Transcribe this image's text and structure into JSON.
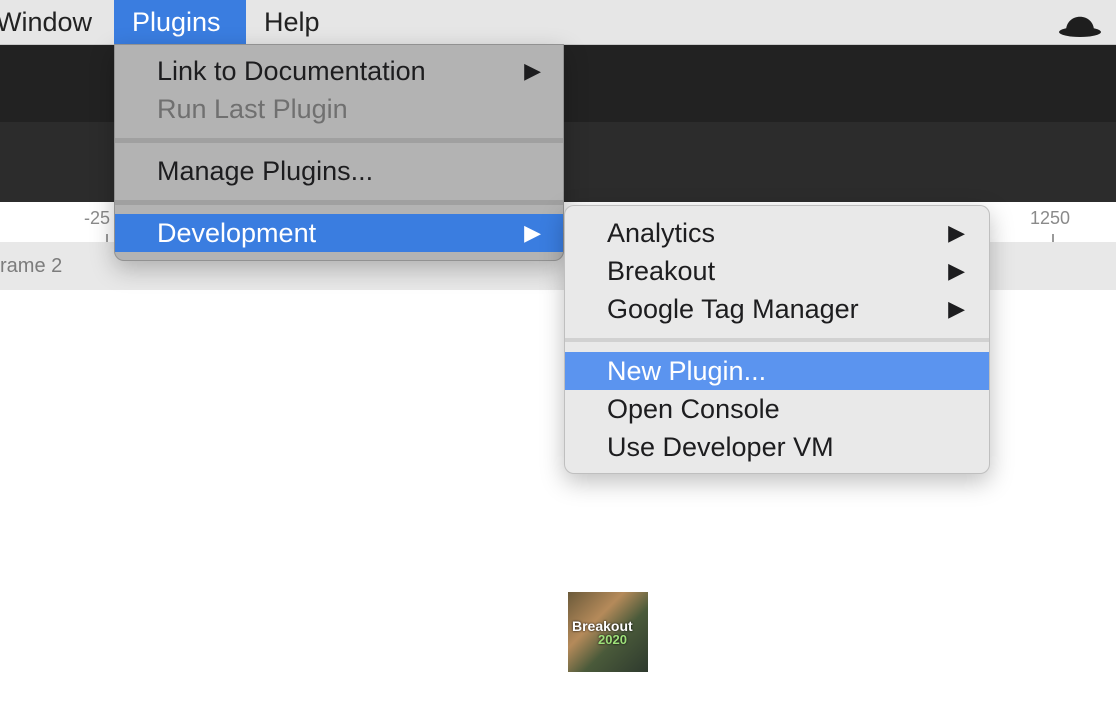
{
  "menubar": {
    "items": [
      {
        "label": "Window"
      },
      {
        "label": "Plugins"
      },
      {
        "label": "Help"
      }
    ]
  },
  "ruler": {
    "ticks": [
      "-25",
      "1250"
    ]
  },
  "canvas": {
    "frame_label": "rame 2",
    "thumbnail": {
      "line1": "Breakout",
      "line2": "2020"
    }
  },
  "plugins_menu": {
    "items": [
      {
        "label": "Link to Documentation",
        "arrow": "▶"
      },
      {
        "label": "Run Last Plugin"
      },
      {
        "label": "Manage Plugins..."
      },
      {
        "label": "Development",
        "arrow": "▶"
      }
    ]
  },
  "development_menu": {
    "items": [
      {
        "label": "Analytics",
        "arrow": "▶"
      },
      {
        "label": "Breakout",
        "arrow": "▶"
      },
      {
        "label": "Google Tag Manager",
        "arrow": "▶"
      },
      {
        "label": "New Plugin..."
      },
      {
        "label": "Open Console"
      },
      {
        "label": "Use Developer VM"
      }
    ]
  },
  "colors": {
    "accent": "#3a7de0",
    "submenu_highlight": "#5b94ef",
    "toolbar": "#222222"
  }
}
